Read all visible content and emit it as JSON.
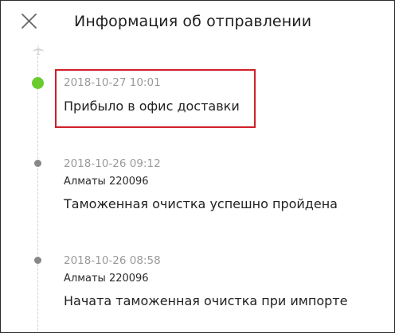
{
  "header": {
    "title": "Информация об отправлении",
    "close_icon": "close-icon"
  },
  "timeline": {
    "top_icon": "airplane-icon",
    "events": [
      {
        "timestamp": "2018-10-27 10:01",
        "location": "",
        "status": "Прибыло в офис доставки",
        "state": "current"
      },
      {
        "timestamp": "2018-10-26 09:12",
        "location": "Алматы 220096",
        "status": "Таможенная очистка успешно пройдена",
        "state": "past"
      },
      {
        "timestamp": "2018-10-26 08:58",
        "location": "Алматы 220096",
        "status": "Начата таможенная очистка при импорте",
        "state": "past"
      }
    ]
  },
  "colors": {
    "current_dot": "#6acb2e",
    "past_dot": "#888888",
    "highlight": "#d0202a"
  }
}
